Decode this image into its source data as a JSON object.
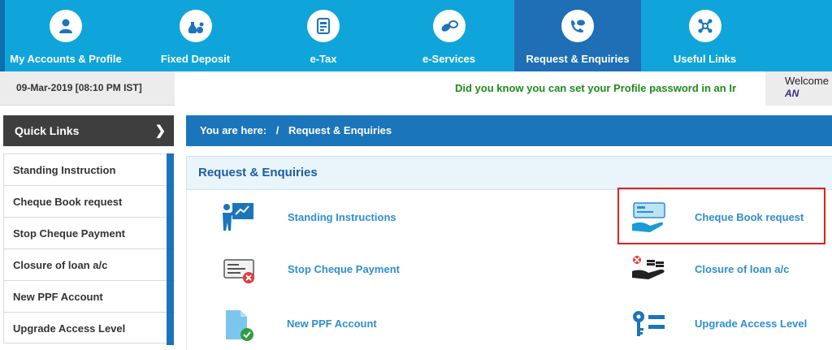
{
  "nav": {
    "items": [
      {
        "label": "My Accounts & Profile",
        "icon": "person-icon"
      },
      {
        "label": "Fixed Deposit",
        "icon": "money-bag-icon"
      },
      {
        "label": "e-Tax",
        "icon": "tax-document-icon"
      },
      {
        "label": "e-Services",
        "icon": "pills-icon"
      },
      {
        "label": "Request & Enquiries",
        "icon": "phone-chat-icon",
        "active": true
      },
      {
        "label": "Useful Links",
        "icon": "links-network-icon"
      }
    ]
  },
  "status_bar": {
    "datetime": "09-Mar-2019 [08:10 PM IST]",
    "marquee": "Did you know you can set your Profile password in an Ir",
    "welcome_label": "Welcome",
    "user": "AN"
  },
  "quick_links": {
    "title": "Quick Links",
    "items": [
      {
        "label": "Standing Instruction"
      },
      {
        "label": "Cheque Book request"
      },
      {
        "label": "Stop Cheque Payment"
      },
      {
        "label": "Closure of loan a/c"
      },
      {
        "label": "New PPF Account"
      },
      {
        "label": "Upgrade Access Level"
      }
    ]
  },
  "breadcrumb": {
    "prefix": "You are here:",
    "separator": "/",
    "current": "Request & Enquiries"
  },
  "panel": {
    "title": "Request & Enquiries",
    "services": [
      {
        "label": "Standing Instructions",
        "icon": "presentation-icon"
      },
      {
        "label": "Cheque Book request",
        "icon": "cheque-hand-icon",
        "highlighted": true
      },
      {
        "label": "Stop Cheque Payment",
        "icon": "cheque-cancel-icon"
      },
      {
        "label": "Closure of loan a/c",
        "icon": "hand-coins-cancel-icon"
      },
      {
        "label": "New PPF Account",
        "icon": "document-check-icon"
      },
      {
        "label": "Upgrade Access Level",
        "icon": "key-list-icon"
      }
    ]
  },
  "colors": {
    "nav_bg": "#0fa5da",
    "nav_active": "#1e6fb5",
    "brand_blue": "#1b75bb",
    "link_blue": "#2f8ed0",
    "marquee_green": "#1c8c1c",
    "highlight_red": "#e02020"
  }
}
